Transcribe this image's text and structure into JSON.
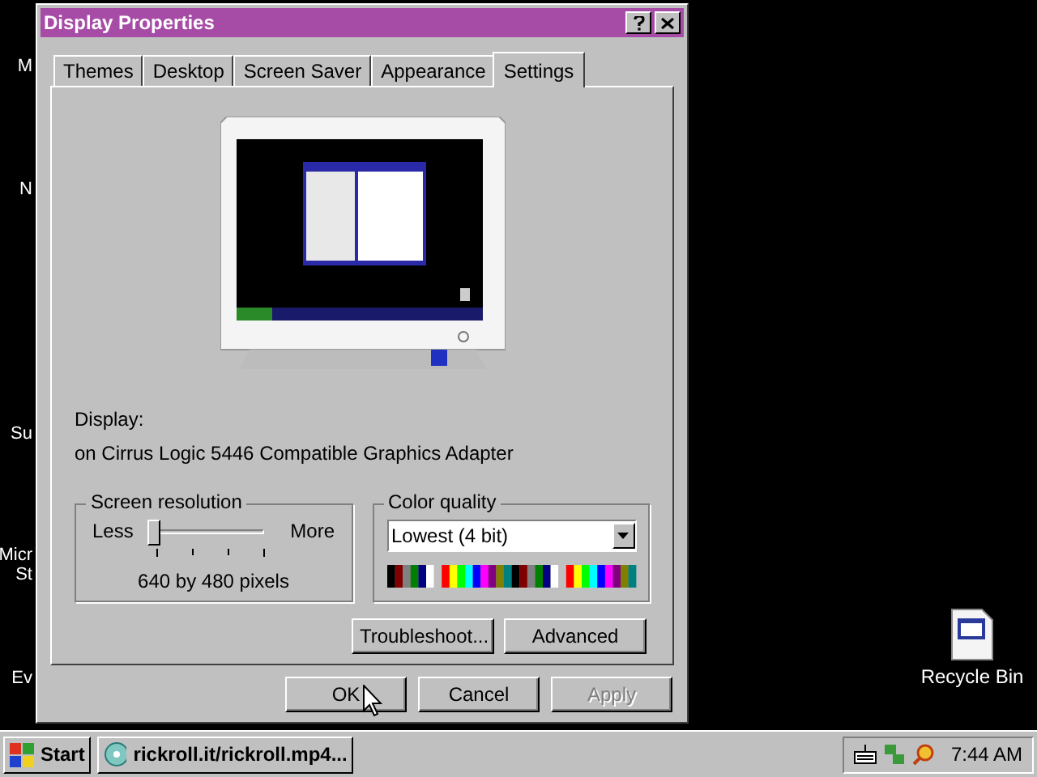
{
  "desktop_icons": [
    {
      "label": "M"
    },
    {
      "label": "N"
    },
    {
      "label": "Su"
    },
    {
      "label": "Micr"
    },
    {
      "label": "St"
    },
    {
      "label": "Ev"
    },
    {
      "label": "Recycle Bin"
    }
  ],
  "window": {
    "title": "Display Properties"
  },
  "tabs": [
    {
      "label": "Themes",
      "selected": false
    },
    {
      "label": "Desktop",
      "selected": false
    },
    {
      "label": "Screen Saver",
      "selected": false
    },
    {
      "label": "Appearance",
      "selected": false
    },
    {
      "label": "Settings",
      "selected": true
    }
  ],
  "display": {
    "label": "Display:",
    "adapter": "on Cirrus Logic 5446 Compatible Graphics Adapter"
  },
  "screen_resolution": {
    "title": "Screen resolution",
    "min_label": "Less",
    "max_label": "More",
    "level": 0,
    "reading": "640 by 480 pixels"
  },
  "color_quality": {
    "title": "Color quality",
    "value": "Lowest (4 bit)"
  },
  "panel_buttons": [
    {
      "label": "Troubleshoot...",
      "disabled": false
    },
    {
      "label": "Advanced",
      "disabled": false
    }
  ],
  "dialog_buttons": [
    {
      "label": "OK",
      "disabled": false
    },
    {
      "label": "Cancel",
      "disabled": false
    },
    {
      "label": "Apply",
      "disabled": true
    }
  ],
  "taskbar": {
    "start": "Start",
    "tasks": [
      {
        "label": "rickroll.it/rickroll.mp4...",
        "selected": false
      }
    ],
    "clock": "7:44 AM"
  }
}
